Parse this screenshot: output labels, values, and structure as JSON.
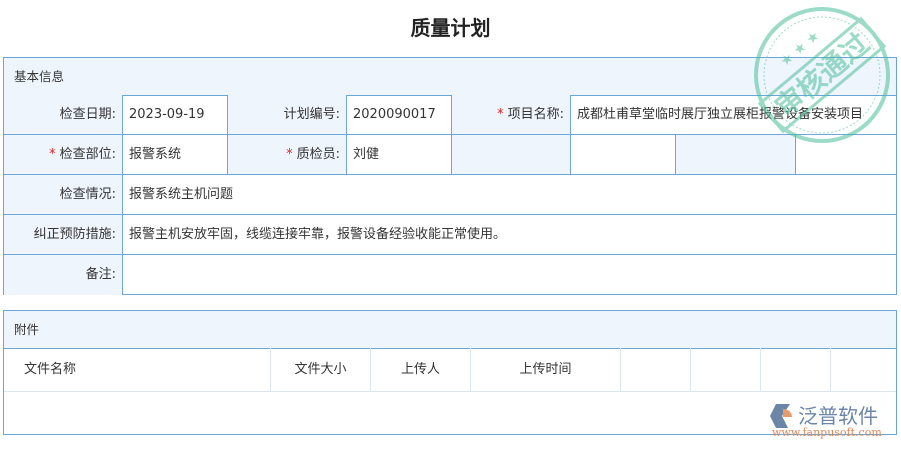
{
  "title": "质量计划",
  "basic": {
    "header": "基本信息",
    "fields": {
      "date_label": "检查日期:",
      "date": "2023-09-19",
      "plan_no_label": "计划编号:",
      "plan_no": "2020090017",
      "project_label": "项目名称:",
      "project": "成都杜甫草堂临时展厅独立展柜报警设备安装项目",
      "dept_label": "检查部位:",
      "dept": "报警系统",
      "inspector_label": "质检员:",
      "inspector": "刘健",
      "situation_label": "检查情况:",
      "situation": "报警系统主机问题",
      "measures_label": "纠正预防措施:",
      "measures": "报警主机安放牢固，线缆连接牢靠，报警设备经验收能正常使用。",
      "remark_label": "备注:",
      "remark": ""
    }
  },
  "attachments": {
    "header": "附件",
    "columns": [
      "文件名称",
      "文件大小",
      "上传人",
      "上传时间"
    ]
  },
  "stamp": {
    "text": "审核通过",
    "color": "#4cbf9a"
  },
  "logo": {
    "name": "泛普软件",
    "url": "www.fanpusoft.com"
  },
  "required_mark": "*"
}
